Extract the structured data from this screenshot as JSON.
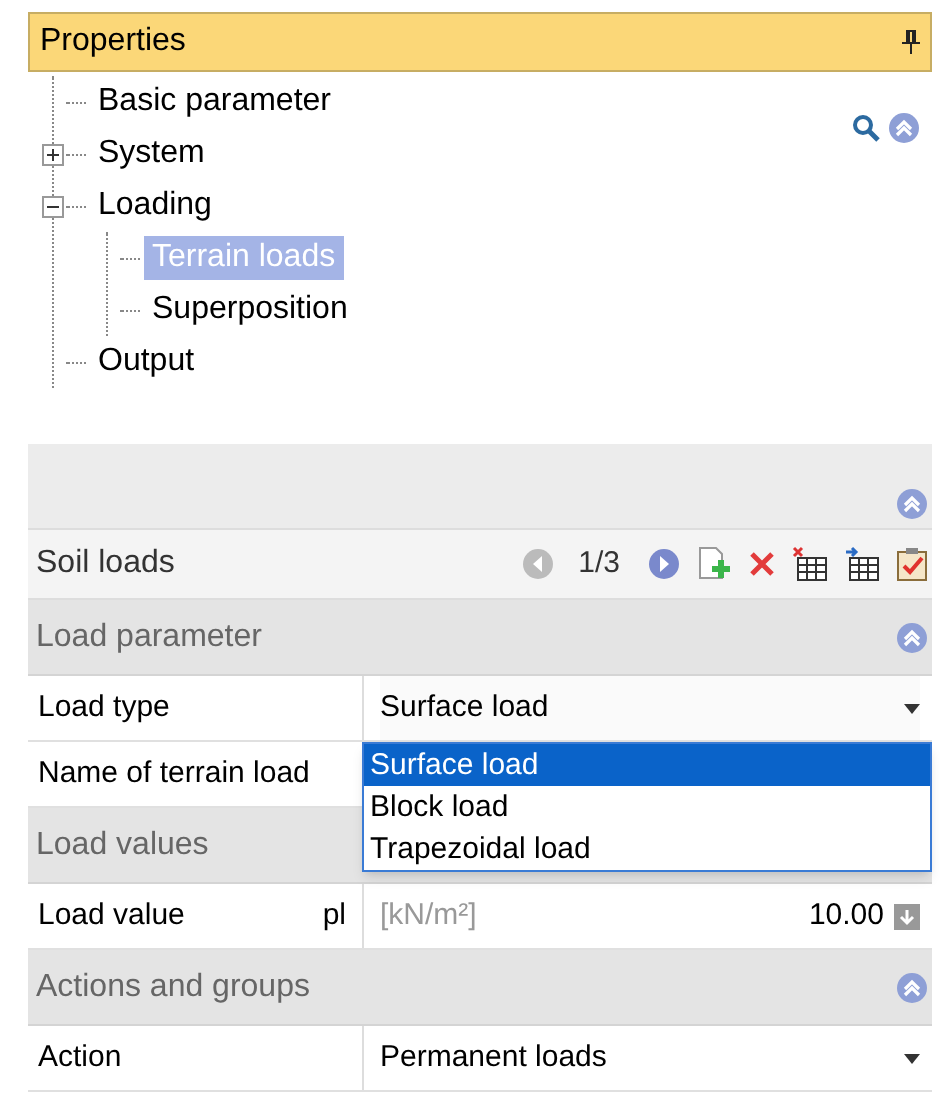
{
  "panel": {
    "title": "Properties"
  },
  "tree": [
    {
      "label": "Basic parameter",
      "selected": false
    },
    {
      "label": "System",
      "expanded": false,
      "selected": false
    },
    {
      "label": "Loading",
      "expanded": true,
      "selected": false,
      "children": [
        {
          "label": "Terrain loads",
          "selected": true
        },
        {
          "label": "Superposition",
          "selected": false
        }
      ]
    },
    {
      "label": "Output",
      "selected": false
    }
  ],
  "navigator": {
    "title": "Soil loads",
    "counter": "1/3"
  },
  "groups": [
    {
      "title": "Load parameter",
      "collapsible": true,
      "rows": [
        {
          "kind": "dropdown",
          "label": "Load type",
          "value": "Surface load",
          "open": true,
          "options": [
            {
              "label": "Surface load",
              "selected": true
            },
            {
              "label": "Block load",
              "selected": false
            },
            {
              "label": "Trapezoidal load",
              "selected": false
            }
          ]
        },
        {
          "kind": "text",
          "label": "Name of terrain load"
        }
      ]
    },
    {
      "title": "Load values",
      "collapsible": false,
      "rows": [
        {
          "kind": "number",
          "label": "Load value",
          "symbol": "pl",
          "unit": "[kN/m²]",
          "value": "10.00"
        }
      ]
    },
    {
      "title": "Actions and groups",
      "collapsible": true,
      "rows": [
        {
          "kind": "dropdown",
          "label": "Action",
          "value": "Permanent loads",
          "open": false
        }
      ]
    }
  ]
}
